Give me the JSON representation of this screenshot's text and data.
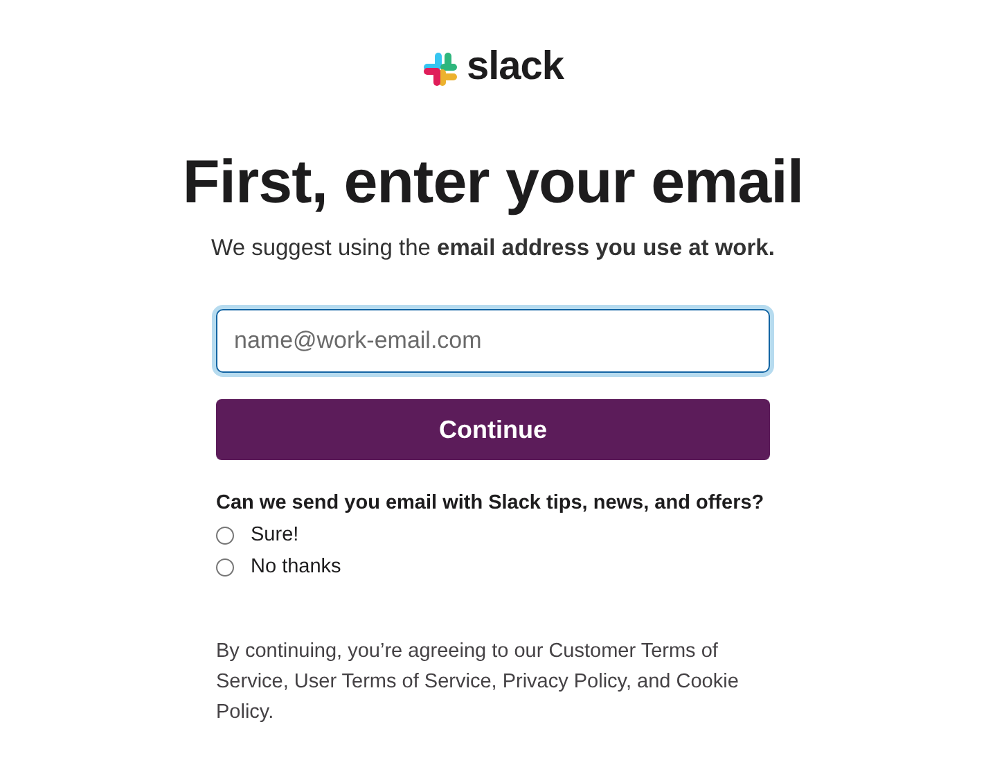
{
  "logo": {
    "text": "slack"
  },
  "heading": "First, enter your email",
  "subtitle": "We suggest using the **email address you use at work.**",
  "email_field": {
    "placeholder": "name@work-email.com",
    "focused": true
  },
  "continue_button": "Continue",
  "newsletter": {
    "question": "Can we send you email with Slack tips, news, and offers?",
    "options": [
      {
        "label": "Sure!",
        "selected": false
      },
      {
        "label": "No thanks",
        "selected": false
      }
    ]
  },
  "terms": "By continuing, you’re agreeing to our Customer Terms of Service, User Terms of Service, Privacy Policy, and Cookie Policy."
}
